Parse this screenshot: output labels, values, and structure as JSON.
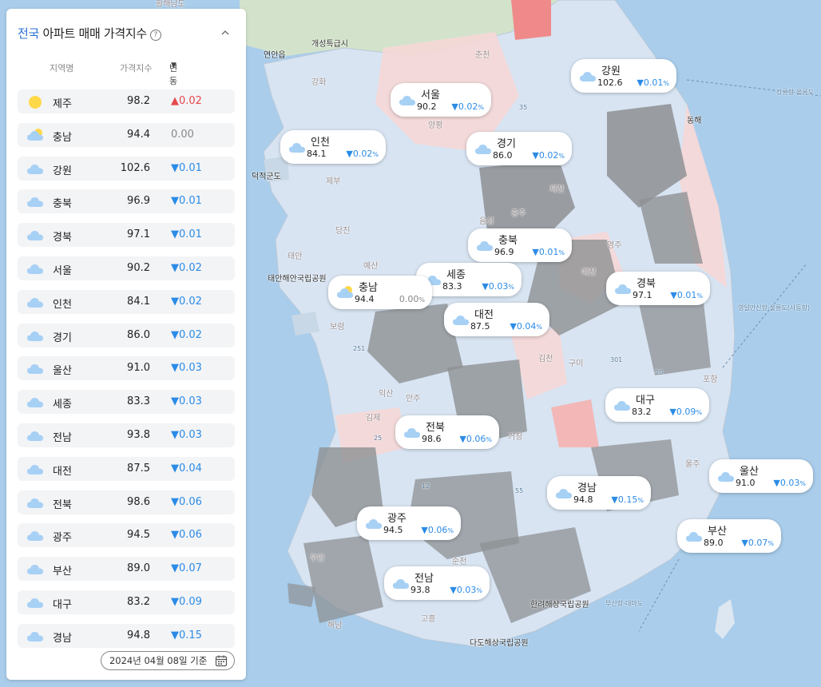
{
  "panel": {
    "title_accent": "전국",
    "title_rest": " 아파트 매매 가격지수",
    "help_icon_text": "?",
    "columns": {
      "region": "지역명",
      "index": "가격지수",
      "change": "변동률(%)"
    },
    "date_label": "2024년 04월 08일 기준"
  },
  "rows": [
    {
      "name": "제주",
      "index": "98.2",
      "change": "0.02",
      "direction": "up",
      "icon": "sun-icon"
    },
    {
      "name": "충남",
      "index": "94.4",
      "change": "0.00",
      "direction": "flat",
      "icon": "partly-cloudy-icon"
    },
    {
      "name": "강원",
      "index": "102.6",
      "change": "0.01",
      "direction": "down",
      "icon": "cloud-icon"
    },
    {
      "name": "충북",
      "index": "96.9",
      "change": "0.01",
      "direction": "down",
      "icon": "cloud-icon"
    },
    {
      "name": "경북",
      "index": "97.1",
      "change": "0.01",
      "direction": "down",
      "icon": "cloud-icon"
    },
    {
      "name": "서울",
      "index": "90.2",
      "change": "0.02",
      "direction": "down",
      "icon": "cloud-icon"
    },
    {
      "name": "인천",
      "index": "84.1",
      "change": "0.02",
      "direction": "down",
      "icon": "cloud-icon"
    },
    {
      "name": "경기",
      "index": "86.0",
      "change": "0.02",
      "direction": "down",
      "icon": "cloud-icon"
    },
    {
      "name": "울산",
      "index": "91.0",
      "change": "0.03",
      "direction": "down",
      "icon": "cloud-icon"
    },
    {
      "name": "세종",
      "index": "83.3",
      "change": "0.03",
      "direction": "down",
      "icon": "cloud-icon"
    },
    {
      "name": "전남",
      "index": "93.8",
      "change": "0.03",
      "direction": "down",
      "icon": "cloud-icon"
    },
    {
      "name": "대전",
      "index": "87.5",
      "change": "0.04",
      "direction": "down",
      "icon": "cloud-icon"
    },
    {
      "name": "전북",
      "index": "98.6",
      "change": "0.06",
      "direction": "down",
      "icon": "cloud-icon"
    },
    {
      "name": "광주",
      "index": "94.5",
      "change": "0.06",
      "direction": "down",
      "icon": "cloud-icon"
    },
    {
      "name": "부산",
      "index": "89.0",
      "change": "0.07",
      "direction": "down",
      "icon": "cloud-icon"
    },
    {
      "name": "대구",
      "index": "83.2",
      "change": "0.09",
      "direction": "down",
      "icon": "cloud-icon"
    },
    {
      "name": "경남",
      "index": "94.8",
      "change": "0.15",
      "direction": "down",
      "icon": "cloud-icon"
    }
  ],
  "map_labels": [
    {
      "name": "강원",
      "index": "102.6",
      "change": "0.01",
      "direction": "down",
      "icon": "cloud-icon"
    },
    {
      "name": "서울",
      "index": "90.2",
      "change": "0.02",
      "direction": "down",
      "icon": "cloud-icon"
    },
    {
      "name": "인천",
      "index": "84.1",
      "change": "0.02",
      "direction": "down",
      "icon": "cloud-icon"
    },
    {
      "name": "경기",
      "index": "86.0",
      "change": "0.02",
      "direction": "down",
      "icon": "cloud-icon"
    },
    {
      "name": "충북",
      "index": "96.9",
      "change": "0.01",
      "direction": "down",
      "icon": "cloud-icon"
    },
    {
      "name": "세종",
      "index": "83.3",
      "change": "0.03",
      "direction": "down",
      "icon": "cloud-icon"
    },
    {
      "name": "충남",
      "index": "94.4",
      "change": "0.00",
      "direction": "flat",
      "icon": "partly-cloudy-icon"
    },
    {
      "name": "경북",
      "index": "97.1",
      "change": "0.01",
      "direction": "down",
      "icon": "cloud-icon"
    },
    {
      "name": "대전",
      "index": "87.5",
      "change": "0.04",
      "direction": "down",
      "icon": "cloud-icon"
    },
    {
      "name": "대구",
      "index": "83.2",
      "change": "0.09",
      "direction": "down",
      "icon": "cloud-icon"
    },
    {
      "name": "전북",
      "index": "98.6",
      "change": "0.06",
      "direction": "down",
      "icon": "cloud-icon"
    },
    {
      "name": "울산",
      "index": "91.0",
      "change": "0.03",
      "direction": "down",
      "icon": "cloud-icon"
    },
    {
      "name": "경남",
      "index": "94.8",
      "change": "0.15",
      "direction": "down",
      "icon": "cloud-icon"
    },
    {
      "name": "광주",
      "index": "94.5",
      "change": "0.06",
      "direction": "down",
      "icon": "cloud-icon"
    },
    {
      "name": "부산",
      "index": "89.0",
      "change": "0.07",
      "direction": "down",
      "icon": "cloud-icon"
    },
    {
      "name": "전남",
      "index": "93.8",
      "change": "0.03",
      "direction": "down",
      "icon": "cloud-icon"
    }
  ],
  "place_names": [
    "황해남도",
    "연안읍",
    "개성특급시",
    "춘천",
    "강화",
    "양평",
    "제천",
    "충주",
    "음성",
    "덕적군도",
    "제부",
    "당진",
    "태안",
    "예산",
    "태안해안국립공원",
    "보령",
    "영주",
    "예천",
    "김천",
    "구미",
    "포항",
    "익산",
    "안주",
    "김제",
    "거창",
    "울주",
    "무안",
    "순천",
    "고흥",
    "해남",
    "동해",
    "한려해상국립공원",
    "다도해상국립공원",
    "강릉항-울릉도",
    "영일만신항-울릉도(사동항)",
    "부산항-대마도",
    "301",
    "20",
    "35",
    "55",
    "251",
    "25",
    "12"
  ],
  "colors": {
    "accent": "#2a6fd6",
    "down": "#2b8be6",
    "up": "#e5484d",
    "sea": "#a9cdeb",
    "rise_strong": "#f08a8a"
  }
}
